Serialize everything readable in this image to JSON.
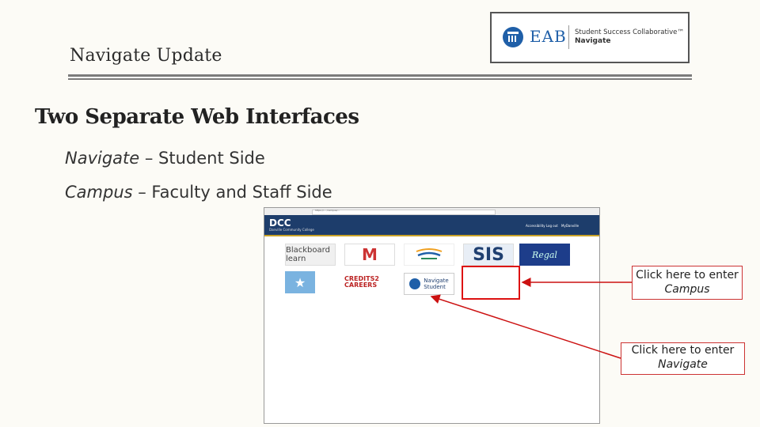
{
  "slide": {
    "title": "Navigate Update",
    "heading": "Two Separate Web Interfaces",
    "bullets": [
      {
        "italic": "Navigate",
        "rest": " – Student Side"
      },
      {
        "italic": "Campus",
        "rest": " – Faculty and Staff Side"
      }
    ]
  },
  "logo": {
    "brand": "EAB",
    "line1": "Student Success Collaborative™",
    "line2": "Navigate"
  },
  "screenshot": {
    "url": "https://... /campus/...",
    "portal_title": "DCC",
    "portal_subtitle": "Danville Community College",
    "header_links": "Accessibility  Log out",
    "header_links2": "MyDanville",
    "tiles": {
      "blackboard": "Blackboard learn",
      "gmail": "M",
      "gmail_label": "Gmail",
      "sis": "SIS",
      "regal": "Regal",
      "star": "★",
      "credits": "CREDITS2 CAREERS",
      "navigate_line1": "Navigate",
      "navigate_line2": "Student"
    }
  },
  "callouts": {
    "campus_prefix": "Click here to enter",
    "campus_italic": "Campus",
    "navigate_prefix": "Click here to enter",
    "navigate_italic": "Navigate"
  },
  "colors": {
    "arrow": "#cc1111",
    "portal_header": "#1d3d6b",
    "accent_gold": "#c9a227"
  }
}
